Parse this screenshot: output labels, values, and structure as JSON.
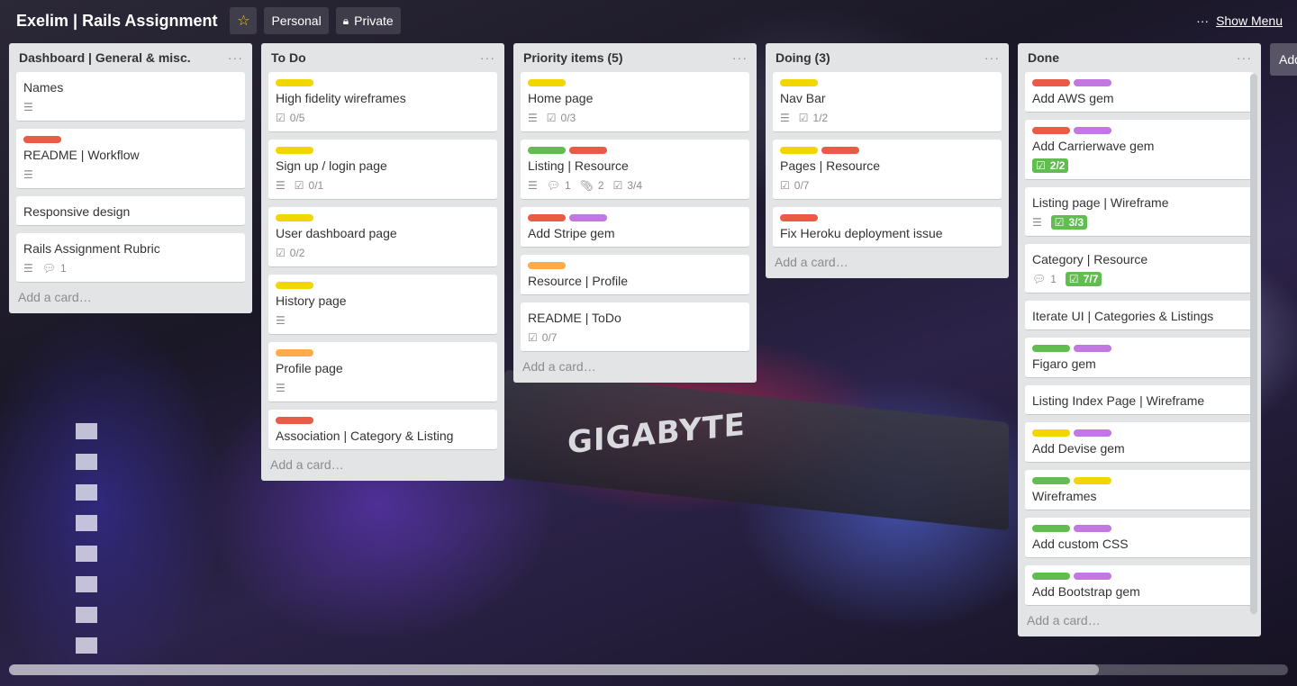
{
  "header": {
    "board_title": "Exelim | Rails Assignment",
    "team": "Personal",
    "visibility": "Private",
    "show_menu": "Show Menu"
  },
  "colors": {
    "green": "#61bd4f",
    "yellow": "#f2d600",
    "orange": "#ffab4a",
    "red": "#eb5a46",
    "purple": "#c377e0"
  },
  "add_card_label": "Add a card…",
  "add_list_label": "Add",
  "lists": [
    {
      "title": "Dashboard | General & misc.",
      "cards": [
        {
          "title": "Names",
          "labels": [],
          "badges": {
            "desc": true
          }
        },
        {
          "title": "README | Workflow",
          "labels": [
            "red"
          ],
          "badges": {
            "desc": true
          }
        },
        {
          "title": "Responsive design",
          "labels": [],
          "badges": {}
        },
        {
          "title": "Rails Assignment Rubric",
          "labels": [],
          "badges": {
            "desc": true,
            "comments": "1"
          }
        }
      ]
    },
    {
      "title": "To Do",
      "cards": [
        {
          "title": "High fidelity wireframes",
          "labels": [
            "yellow"
          ],
          "badges": {
            "checklist": "0/5"
          }
        },
        {
          "title": "Sign up / login page",
          "labels": [
            "yellow"
          ],
          "badges": {
            "desc": true,
            "checklist": "0/1"
          }
        },
        {
          "title": "User dashboard page",
          "labels": [
            "yellow"
          ],
          "badges": {
            "checklist": "0/2"
          }
        },
        {
          "title": "History page",
          "labels": [
            "yellow"
          ],
          "badges": {
            "desc": true
          }
        },
        {
          "title": "Profile page",
          "labels": [
            "orange"
          ],
          "badges": {
            "desc": true
          }
        },
        {
          "title": "Association | Category & Listing",
          "labels": [
            "red"
          ],
          "badges": {}
        }
      ]
    },
    {
      "title": "Priority items (5)",
      "cards": [
        {
          "title": "Home page",
          "labels": [
            "yellow"
          ],
          "badges": {
            "desc": true,
            "checklist": "0/3"
          }
        },
        {
          "title": "Listing | Resource",
          "labels": [
            "green",
            "red"
          ],
          "badges": {
            "desc": true,
            "comments": "1",
            "attachments": "2",
            "checklist": "3/4"
          }
        },
        {
          "title": "Add Stripe gem",
          "labels": [
            "red",
            "purple"
          ],
          "badges": {}
        },
        {
          "title": "Resource | Profile",
          "labels": [
            "orange"
          ],
          "badges": {}
        },
        {
          "title": "README | ToDo",
          "labels": [],
          "badges": {
            "checklist": "0/7"
          }
        }
      ]
    },
    {
      "title": "Doing (3)",
      "cards": [
        {
          "title": "Nav Bar",
          "labels": [
            "yellow"
          ],
          "badges": {
            "desc": true,
            "checklist": "1/2"
          }
        },
        {
          "title": "Pages | Resource",
          "labels": [
            "yellow",
            "red"
          ],
          "badges": {
            "checklist": "0/7"
          }
        },
        {
          "title": "Fix Heroku deployment issue",
          "labels": [
            "red"
          ],
          "badges": {}
        }
      ]
    },
    {
      "title": "Done",
      "cards": [
        {
          "title": "Add AWS gem",
          "labels": [
            "red",
            "purple"
          ],
          "badges": {}
        },
        {
          "title": "Add Carrierwave gem",
          "labels": [
            "red",
            "purple"
          ],
          "badges": {
            "checklist_complete": "2/2"
          }
        },
        {
          "title": "Listing page | Wireframe",
          "labels": [],
          "badges": {
            "desc": true,
            "checklist_complete": "3/3"
          }
        },
        {
          "title": "Category | Resource",
          "labels": [],
          "badges": {
            "comments": "1",
            "checklist_complete": "7/7"
          }
        },
        {
          "title": "Iterate UI | Categories & Listings",
          "labels": [],
          "badges": {}
        },
        {
          "title": "Figaro gem",
          "labels": [
            "green",
            "purple"
          ],
          "badges": {}
        },
        {
          "title": "Listing Index Page | Wireframe",
          "labels": [],
          "badges": {}
        },
        {
          "title": "Add Devise gem",
          "labels": [
            "yellow",
            "purple"
          ],
          "badges": {}
        },
        {
          "title": "Wireframes",
          "labels": [
            "green",
            "yellow"
          ],
          "badges": {}
        },
        {
          "title": "Add custom CSS",
          "labels": [
            "green",
            "purple"
          ],
          "badges": {}
        },
        {
          "title": "Add Bootstrap gem",
          "labels": [
            "green",
            "purple"
          ],
          "badges": {}
        }
      ]
    }
  ]
}
